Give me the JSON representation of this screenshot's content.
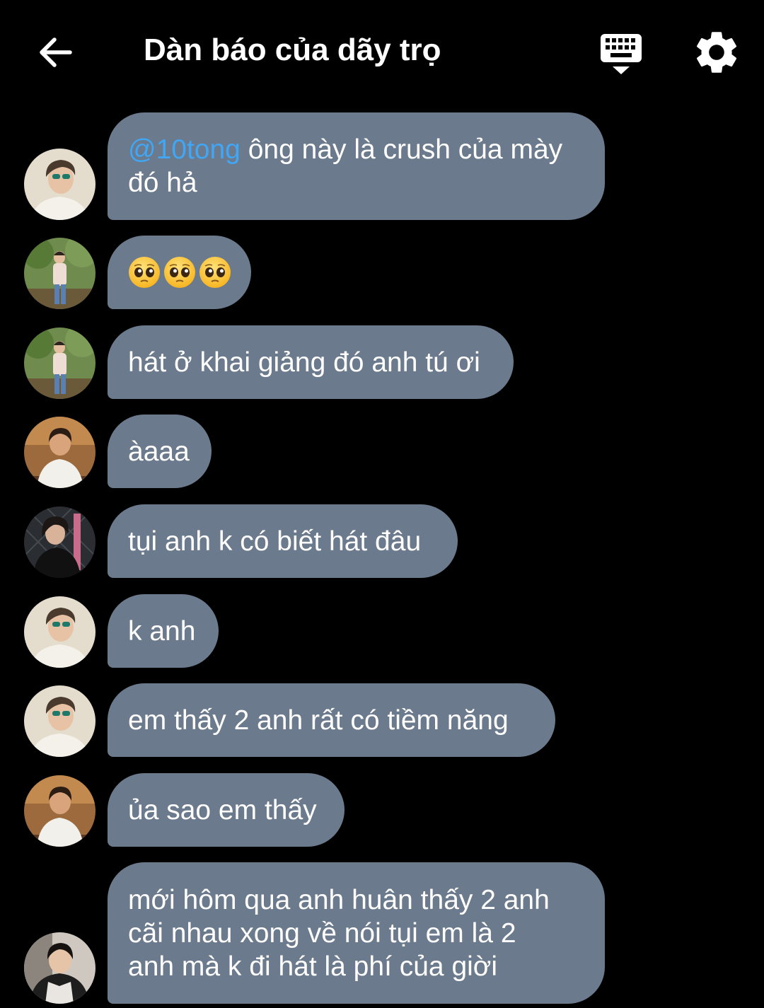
{
  "header": {
    "title": "Dàn báo của dãy trọ",
    "back_icon": "arrow-left-icon",
    "keyboard_icon": "keyboard-hide-icon",
    "settings_icon": "gear-icon"
  },
  "colors": {
    "background": "#000000",
    "bubble": "#6b7a8c",
    "mention": "#41a6f4",
    "text": "#ffffff"
  },
  "messages": [
    {
      "mention": "@10tong",
      "text": " ông này là crush của mày\nđó hả",
      "avatar": "avatar-sunglasses"
    },
    {
      "emoji": [
        "pleading-face-icon",
        "pleading-face-icon",
        "pleading-face-icon"
      ],
      "avatar": "avatar-park"
    },
    {
      "text": "hát ở khai giảng đó anh tú ơi",
      "avatar": "avatar-park"
    },
    {
      "text": "àaaa",
      "avatar": "avatar-cafe"
    },
    {
      "text": "tụi anh k có biết hát đâu",
      "avatar": "avatar-dark"
    },
    {
      "text": "k anh",
      "avatar": "avatar-sunglasses"
    },
    {
      "text": "em thấy 2 anh rất có tiềm năng",
      "avatar": "avatar-sunglasses"
    },
    {
      "text": "ủa sao em thấy",
      "avatar": "avatar-cafe"
    },
    {
      "text": "mới hôm qua anh huân thấy 2 anh\ncãi nhau xong về nói tụi em là 2\nanh mà k đi hát là phí của giời",
      "avatar": "avatar-hoodie"
    }
  ]
}
